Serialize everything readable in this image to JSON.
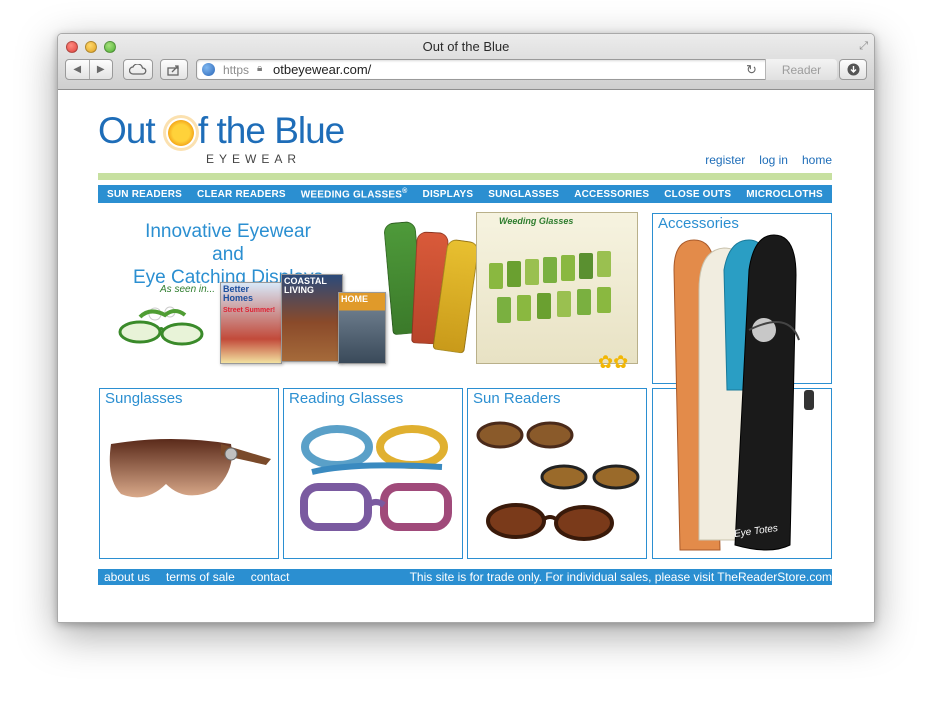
{
  "browser": {
    "window_title": "Out of the Blue",
    "protocol": "https",
    "url": "otbeyewear.com/",
    "reader_label": "Reader",
    "back_glyph": "◀",
    "forward_glyph": "▶",
    "reload_glyph": "↻",
    "fullscreen_glyph": "⤢"
  },
  "site": {
    "logo_main_left": "Out ",
    "logo_main_right": "f the Blue",
    "logo_sub": "EYEWEAR",
    "top_links": [
      "register",
      "log in",
      "home"
    ],
    "nav": [
      "SUN READERS",
      "CLEAR READERS",
      "WEEDING GLASSES",
      "DISPLAYS",
      "SUNGLASSES",
      "ACCESSORIES",
      "CLOSE OUTS",
      "MICROCLOTHS"
    ],
    "nav_registered_mark": "®"
  },
  "hero": {
    "title_line1": "Innovative Eyewear and",
    "title_line2": "Eye Catching Displays",
    "as_seen": "As seen in...",
    "mag1": "Better Homes",
    "mag1_sub": "Street Summer!",
    "mag2": "COASTAL LIVING",
    "mag3": "HOME",
    "display_title": "Weeding Glasses"
  },
  "tiles": {
    "accessories": "Accessories",
    "sunglasses": "Sunglasses",
    "reading": "Reading Glasses",
    "sun_readers": "Sun Readers",
    "case_brand": "Eye Totes"
  },
  "footer": {
    "links": [
      "about us",
      "terms of sale",
      "contact"
    ],
    "notice": "This site is for trade only. For individual sales, please visit TheReaderStore.com"
  },
  "colors": {
    "brand_blue": "#2b8fd1",
    "green_bar": "#c7e0a0"
  }
}
